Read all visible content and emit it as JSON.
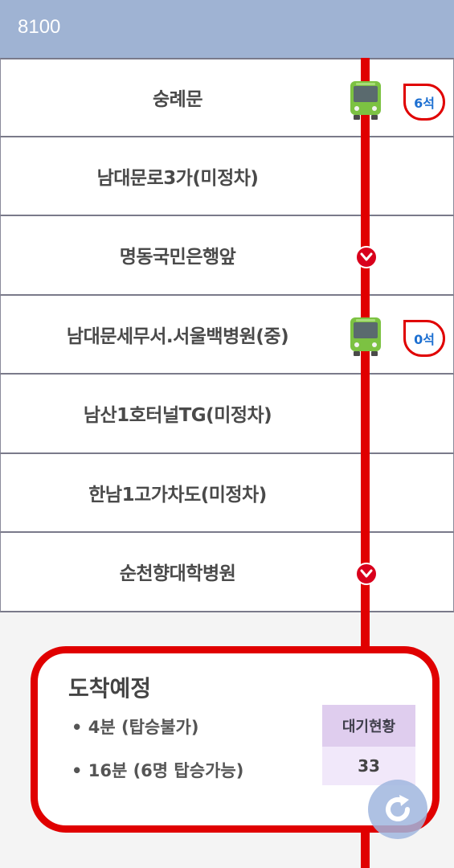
{
  "header": {
    "title": "8100"
  },
  "stops": [
    {
      "name": "숭례문",
      "bus": true,
      "seats": "6석",
      "chevron": false
    },
    {
      "name": "남대문로3가(미정차)",
      "bus": false,
      "seats": null,
      "chevron": false
    },
    {
      "name": "명동국민은행앞",
      "bus": false,
      "seats": null,
      "chevron": true
    },
    {
      "name": "남대문세무서.서울백병원(중)",
      "bus": true,
      "seats": "0석",
      "chevron": false
    },
    {
      "name": "남산1호터널TG(미정차)",
      "bus": false,
      "seats": null,
      "chevron": false
    },
    {
      "name": "한남1고가차도(미정차)",
      "bus": false,
      "seats": null,
      "chevron": false
    },
    {
      "name": "순천향대학병원",
      "bus": false,
      "seats": null,
      "chevron": true
    }
  ],
  "arrival": {
    "title": "도착예정",
    "items": [
      "• 4분 (탑승불가)",
      "• 16분 (6명 탑승가능)"
    ],
    "wait_header": "대기현황",
    "wait_value": "33"
  },
  "icons": {
    "bus": "bus-icon",
    "chevron": "chevron-down-icon",
    "refresh": "refresh-icon"
  },
  "colors": {
    "header_bg": "#9fb3d3",
    "route_line": "#e00000",
    "seat_text": "#1c6fd1",
    "bus_green": "#7cc242"
  }
}
